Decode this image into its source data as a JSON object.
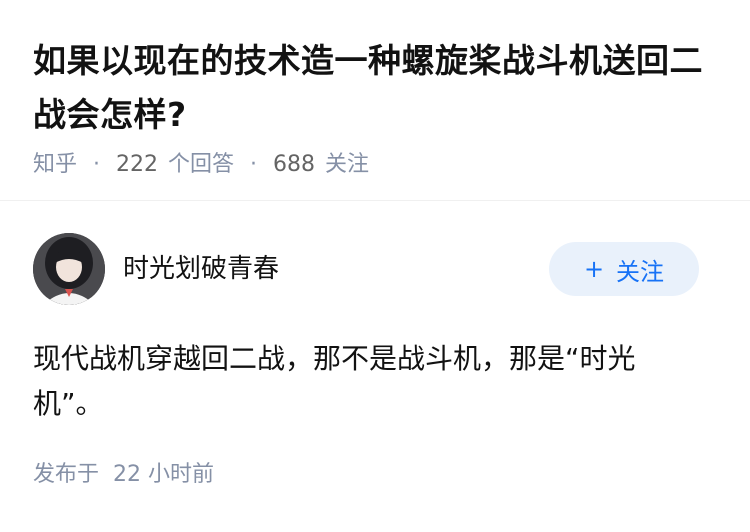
{
  "question": {
    "title": "如果以现在的技术造一种螺旋桨战斗机送回二战会怎样?",
    "source": "知乎",
    "answer_count": "222",
    "answer_label": "个回答",
    "follower_count": "688",
    "follower_label": "关注"
  },
  "answer": {
    "author_name": "时光划破青春",
    "follow_plus": "+",
    "follow_label": "关注",
    "content": "现代战机穿越回二战，那不是战斗机，那是“时光机”。",
    "publish_label": "发布于",
    "publish_time": "22 小时前"
  }
}
